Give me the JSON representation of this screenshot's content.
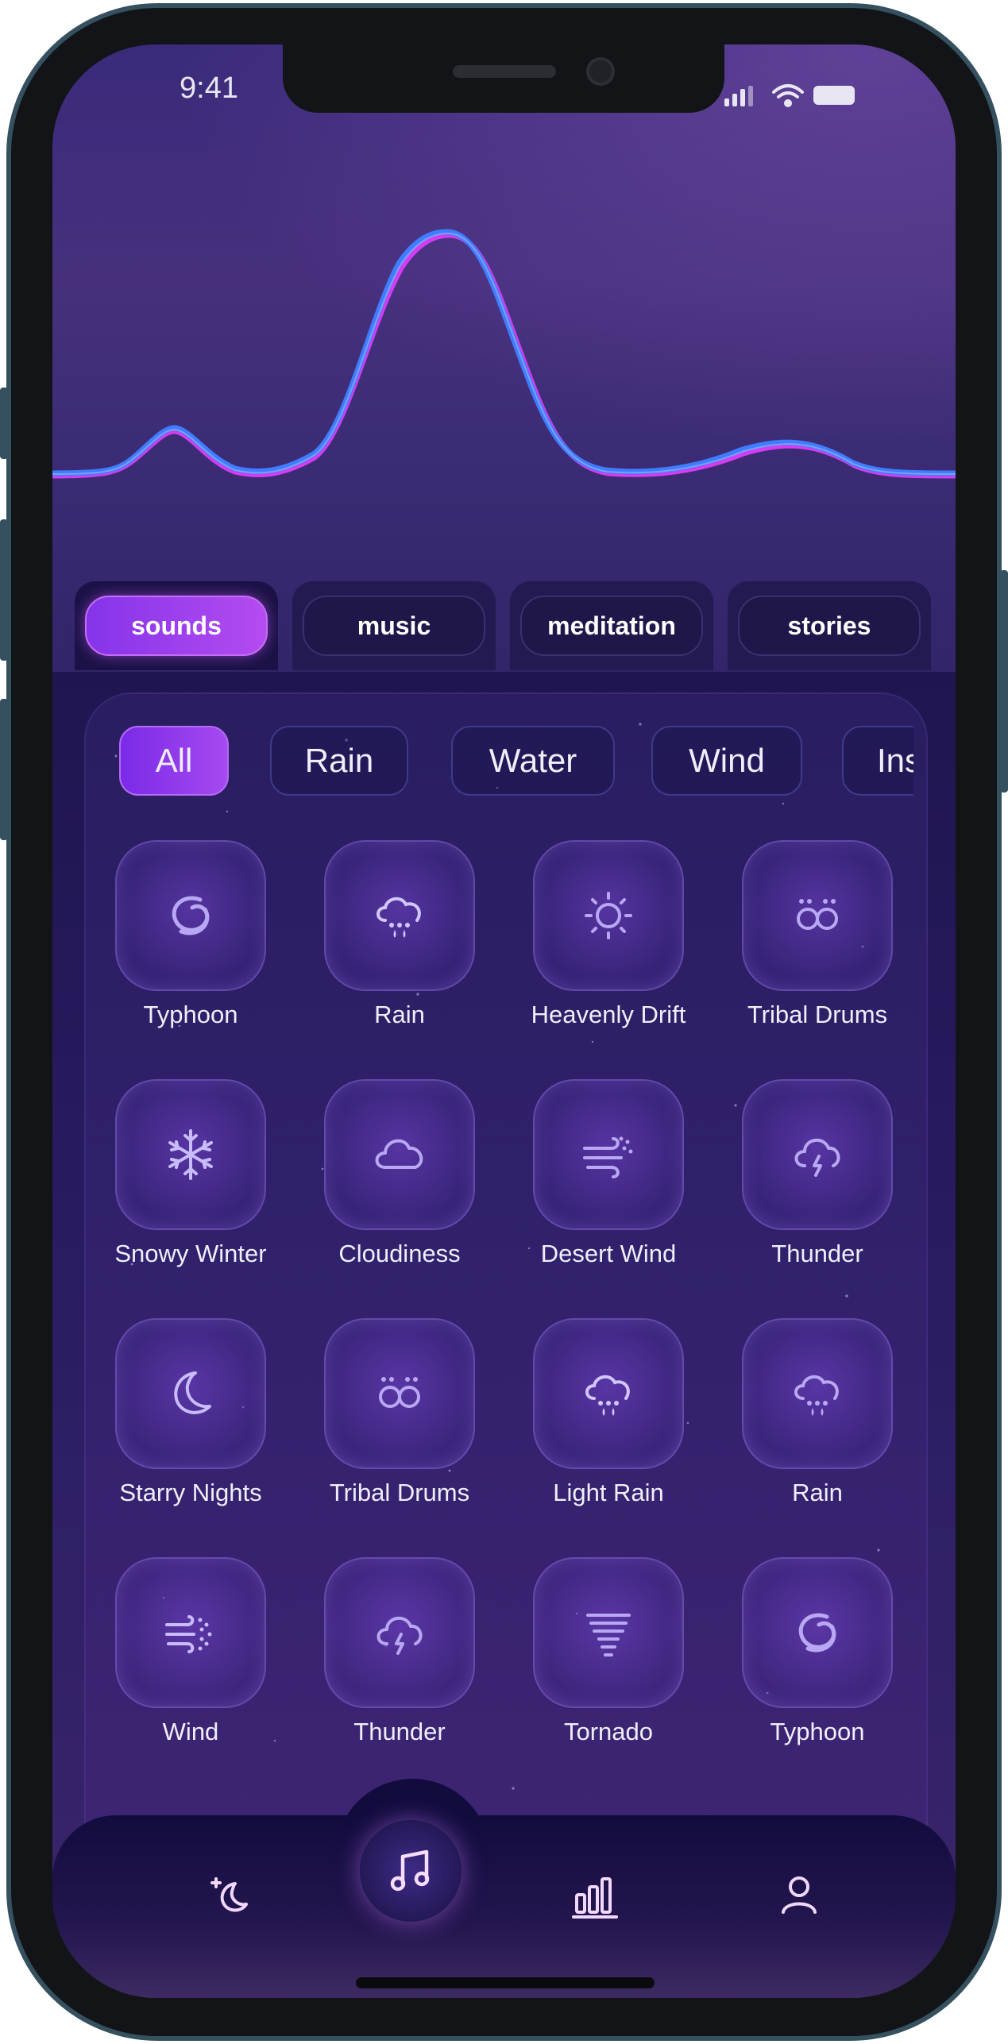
{
  "status_bar": {
    "time": "9:41",
    "icons": [
      "signal-icon",
      "wifi-icon",
      "battery-icon"
    ]
  },
  "tabs": [
    {
      "label": "sounds",
      "active": true
    },
    {
      "label": "music",
      "active": false
    },
    {
      "label": "meditation",
      "active": false
    },
    {
      "label": "stories",
      "active": false
    }
  ],
  "filters": [
    {
      "label": "All",
      "active": true
    },
    {
      "label": "Rain",
      "active": false
    },
    {
      "label": "Water",
      "active": false
    },
    {
      "label": "Wind",
      "active": false
    },
    {
      "label": "Ins",
      "active": false
    }
  ],
  "sounds": [
    {
      "label": "Typhoon",
      "icon": "typhoon-icon"
    },
    {
      "label": "Rain",
      "icon": "rain-cloud-icon"
    },
    {
      "label": "Heavenly Drift",
      "icon": "sun-icon"
    },
    {
      "label": "Tribal Drums",
      "icon": "drums-icon"
    },
    {
      "label": "Snowy Winter",
      "icon": "snowflake-icon"
    },
    {
      "label": "Cloudiness",
      "icon": "cloud-icon"
    },
    {
      "label": "Desert Wind",
      "icon": "wind-icon"
    },
    {
      "label": "Thunder",
      "icon": "thunder-cloud-icon"
    },
    {
      "label": "Starry Nights",
      "icon": "moon-icon"
    },
    {
      "label": "Tribal Drums",
      "icon": "drums-icon"
    },
    {
      "label": "Light Rain",
      "icon": "rain-cloud-icon"
    },
    {
      "label": "Rain",
      "icon": "rain-cloud-icon"
    },
    {
      "label": "Wind",
      "icon": "wind-dots-icon"
    },
    {
      "label": "Thunder",
      "icon": "thunder-cloud-icon"
    },
    {
      "label": "Tornado",
      "icon": "tornado-icon"
    },
    {
      "label": "Typhoon",
      "icon": "typhoon-icon"
    }
  ],
  "nav": [
    {
      "name": "sleep-icon"
    },
    {
      "name": "music-note-icon",
      "active": true
    },
    {
      "name": "stats-icon"
    },
    {
      "name": "profile-icon"
    }
  ],
  "colors": {
    "accent": "#a64af0",
    "wave_blue": "#3f7cff",
    "wave_pink": "#d33cf0"
  }
}
